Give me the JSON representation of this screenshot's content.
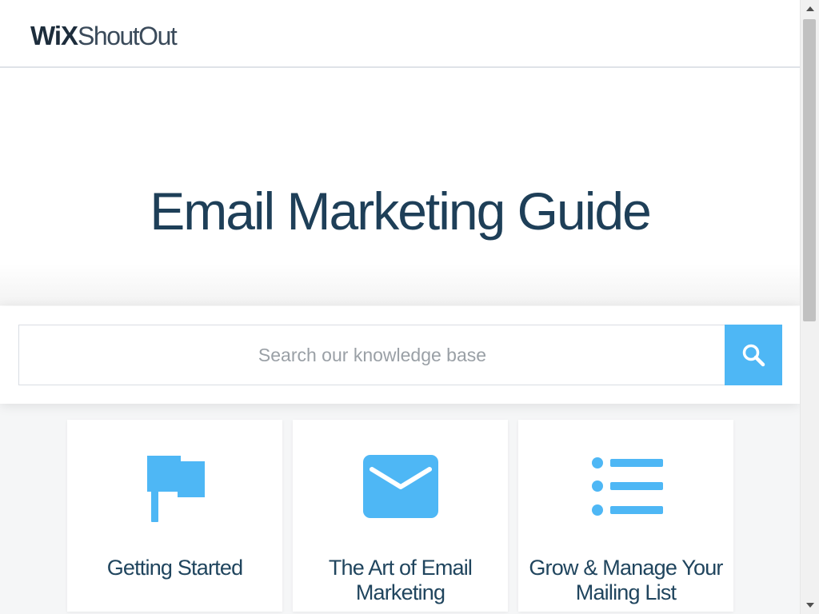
{
  "header": {
    "logo_wix": "WiX",
    "logo_product": "ShoutOut"
  },
  "hero": {
    "title": "Email Marketing Guide"
  },
  "search": {
    "placeholder": "Search our knowledge base",
    "button_icon": "search-icon"
  },
  "categories": [
    {
      "title": "Getting Started",
      "icon": "flag-icon"
    },
    {
      "title": "The Art of Email Marketing",
      "icon": "envelope-icon"
    },
    {
      "title": "Grow & Manage Your Mailing List",
      "icon": "list-icon"
    }
  ],
  "colors": {
    "accent": "#4eb7f5",
    "title_text": "#1e3f58",
    "card_text": "#20455e"
  }
}
